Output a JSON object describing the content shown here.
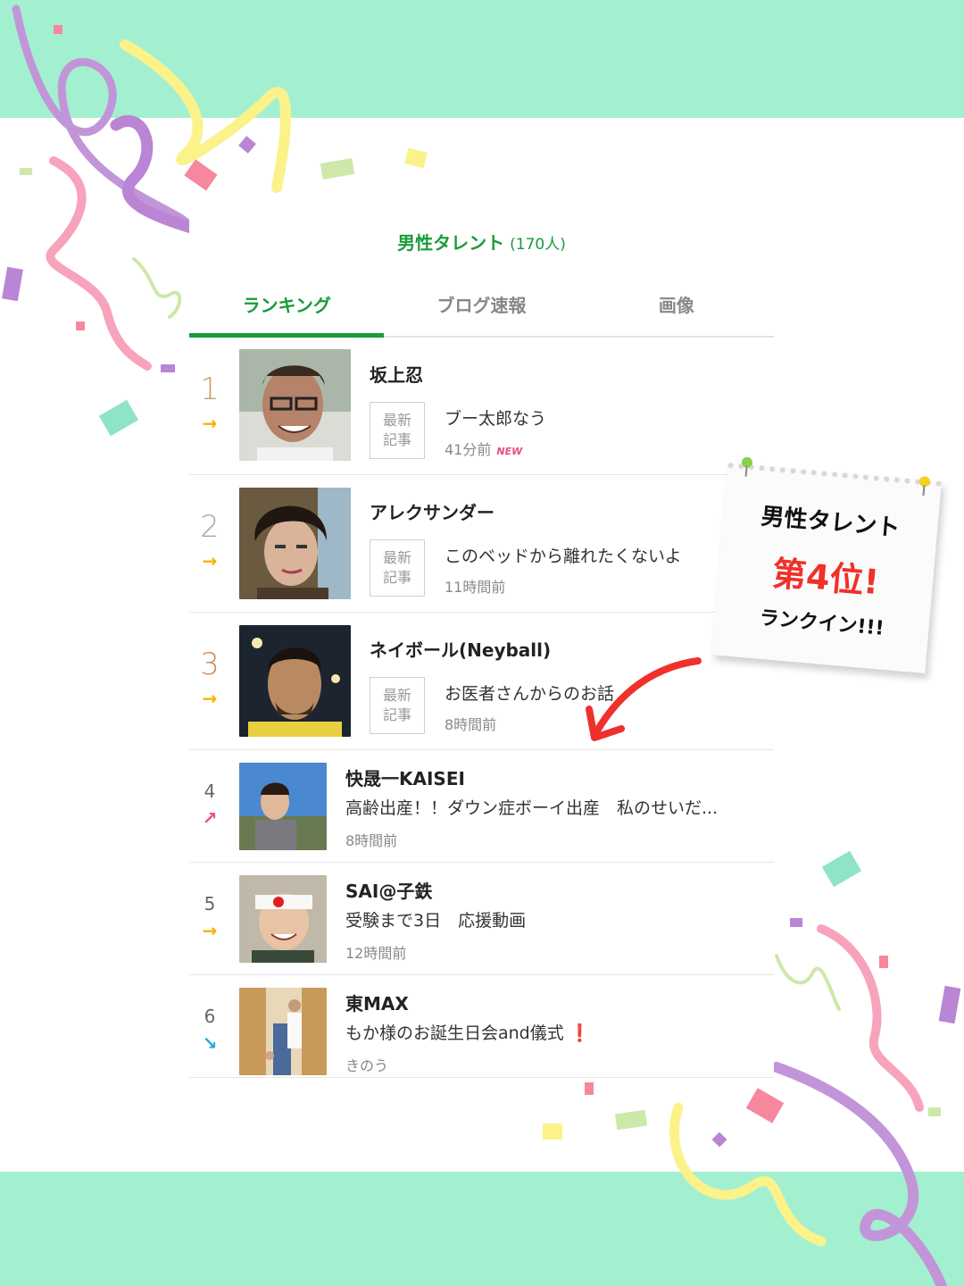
{
  "colors": {
    "band": "#a3f0d1",
    "accent_green": "#1a9a3c",
    "highlight_red": "#f0302a"
  },
  "category": {
    "name": "男性タレント",
    "count": "(170人)"
  },
  "tabs": [
    "ランキング",
    "ブログ速報",
    "画像"
  ],
  "latest_badge": "最新\n記事",
  "rankings": [
    {
      "rank": "1",
      "trend": "→",
      "trend_icon": "arrow-right-icon",
      "name": "坂上忍",
      "post": "ブー太郎なう",
      "time": "41分前",
      "new_tag": "NEW"
    },
    {
      "rank": "2",
      "trend": "→",
      "trend_icon": "arrow-right-icon",
      "name": "アレクサンダー",
      "post": "このベッドから離れたくないよ",
      "time": "11時間前"
    },
    {
      "rank": "3",
      "trend": "→",
      "trend_icon": "arrow-right-icon",
      "name": "ネイボール(Neyball)",
      "post": "お医者さんからのお話",
      "time": "8時間前"
    },
    {
      "rank": "4",
      "trend": "↗",
      "trend_icon": "arrow-up-right-icon",
      "name": "快晟一KAISEI",
      "post": "高齢出産！！ダウン症ボーイ出産　私のせいだ...",
      "time": "8時間前"
    },
    {
      "rank": "5",
      "trend": "→",
      "trend_icon": "arrow-right-icon",
      "name": "SAI@子鉄",
      "post": "受験まで3日　応援動画",
      "time": "12時間前"
    },
    {
      "rank": "6",
      "trend": "↘",
      "trend_icon": "arrow-down-right-icon",
      "name": "東MAX",
      "post": "もか様のお誕生日会and儀式",
      "post_mark": "❗",
      "time": "きのう"
    }
  ],
  "note": {
    "line1": "男性タレント",
    "line2": "第4位!",
    "line3": "ランクイン!!!"
  }
}
